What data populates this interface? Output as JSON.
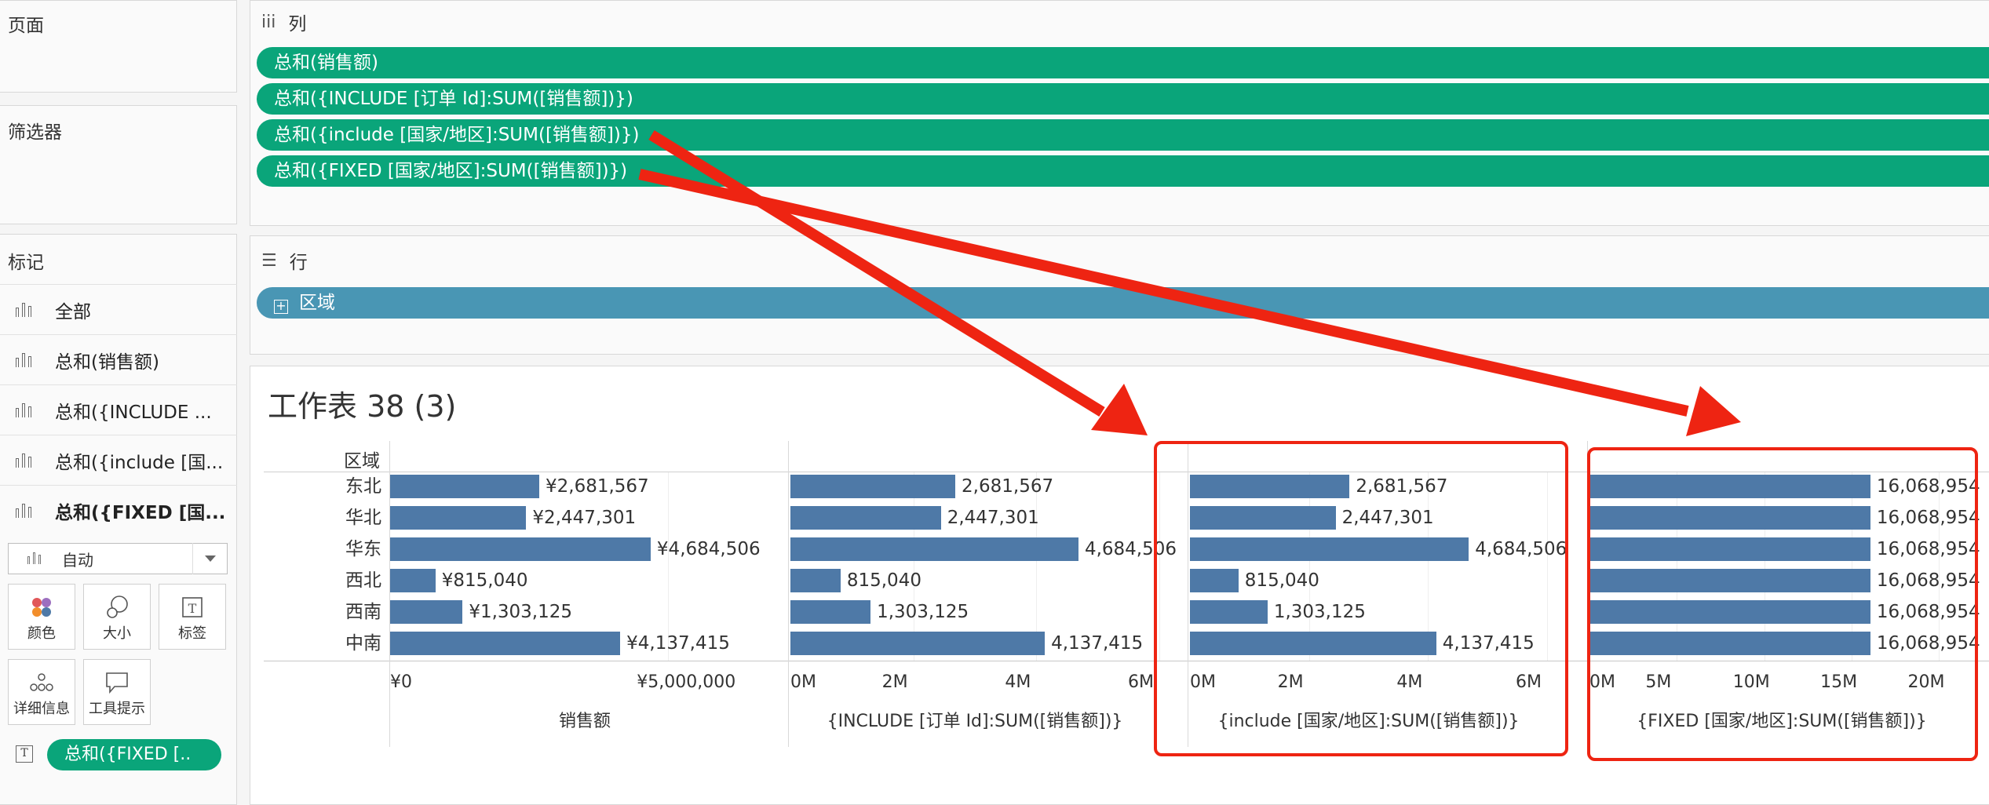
{
  "left_panel": {
    "pages_title": "页面",
    "filters_title": "筛选器",
    "marks_title": "标记",
    "marks": [
      {
        "label": "全部",
        "bold": false
      },
      {
        "label": "总和(销售额)",
        "bold": false
      },
      {
        "label": "总和({INCLUDE ...",
        "bold": false
      },
      {
        "label": "总和({include [国...",
        "bold": false
      },
      {
        "label": "总和({FIXED [国...",
        "bold": true
      }
    ],
    "mark_type": "自动",
    "buttons": {
      "color": "颜色",
      "size": "大小",
      "label": "标签",
      "detail": "详细信息",
      "tooltip": "工具提示"
    },
    "label_pill": "总和({FIXED [.."
  },
  "columns_shelf": {
    "title": "列",
    "pills": [
      "总和(销售额)",
      "总和({INCLUDE [订单 Id]:SUM([销售额])})",
      "总和({include [国家/地区]:SUM([销售额])})",
      "总和({FIXED [国家/地区]:SUM([销售额])})"
    ]
  },
  "rows_shelf": {
    "title": "行",
    "pills": [
      "区域"
    ]
  },
  "view": {
    "title": "工作表 38 (3)",
    "row_header": "区域"
  },
  "chart_data": {
    "type": "bar",
    "categories": [
      "东北",
      "华北",
      "华东",
      "西北",
      "西南",
      "中南"
    ],
    "panes": [
      {
        "axis_title": "销售额",
        "values": [
          2681567,
          2447301,
          4684506,
          815040,
          1303125,
          4137415
        ],
        "labels": [
          "¥2,681,567",
          "¥2,447,301",
          "¥4,684,506",
          "¥815,040",
          "¥1,303,125",
          "¥4,137,415"
        ],
        "ticks": [
          "¥0",
          "¥5,000,000"
        ],
        "xlim": [
          0,
          7000000
        ]
      },
      {
        "axis_title": "{INCLUDE [订单 Id]:SUM([销售额])}",
        "values": [
          2681567,
          2447301,
          4684506,
          815040,
          1303125,
          4137415
        ],
        "labels": [
          "2,681,567",
          "2,447,301",
          "4,684,506",
          "815,040",
          "1,303,125",
          "4,137,415"
        ],
        "ticks": [
          "0M",
          "2M",
          "4M",
          "6M"
        ],
        "xlim": [
          0,
          6000000
        ]
      },
      {
        "axis_title": "{include [国家/地区]:SUM([销售额])}",
        "values": [
          2681567,
          2447301,
          4684506,
          815040,
          1303125,
          4137415
        ],
        "labels": [
          "2,681,567",
          "2,447,301",
          "4,684,506",
          "815,040",
          "1,303,125",
          "4,137,415"
        ],
        "ticks": [
          "0M",
          "2M",
          "4M",
          "6M"
        ],
        "xlim": [
          0,
          6000000
        ]
      },
      {
        "axis_title": "{FIXED [国家/地区]:SUM([销售额])}",
        "values": [
          16068954,
          16068954,
          16068954,
          16068954,
          16068954,
          16068954
        ],
        "labels": [
          "16,068,954",
          "16,068,954",
          "16,068,954",
          "16,068,954",
          "16,068,954",
          "16,068,954"
        ],
        "ticks": [
          "0M",
          "5M",
          "10M",
          "15M",
          "20M"
        ],
        "xlim": [
          0,
          22000000
        ]
      }
    ]
  },
  "colors": {
    "bar": "#4e79a7",
    "measure_pill": "#0aa57a",
    "dimension_pill": "#4996b4",
    "annotation": "#ee2412"
  }
}
